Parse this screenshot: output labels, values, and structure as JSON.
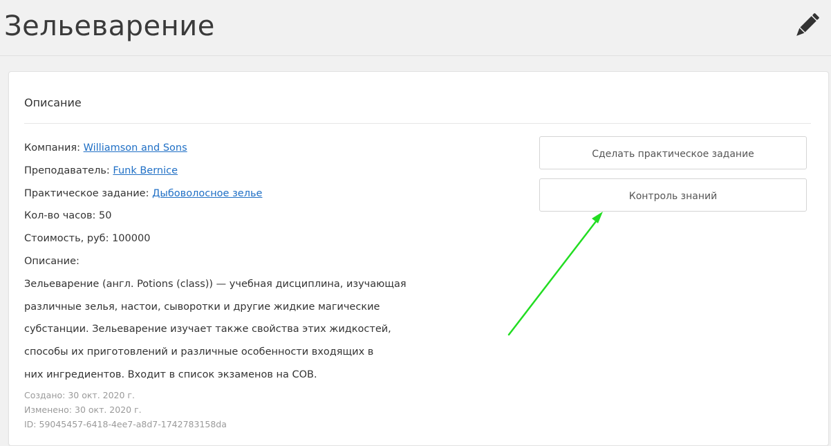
{
  "header": {
    "title": "Зельеварение",
    "edit_icon": "pencil-icon"
  },
  "card": {
    "section_title": "Описание",
    "company": {
      "label": "Компания: ",
      "value": "Williamson and Sons"
    },
    "teacher": {
      "label": "Преподаватель: ",
      "value": "Funk Bernice"
    },
    "practical_task": {
      "label": "Практическое задание: ",
      "value": "Дыбоволосное зелье"
    },
    "hours": "Кол-во часов: 50",
    "cost": "Стоимость, руб: 100000",
    "description_label": "Описание:",
    "description_lines": [
      "Зельеварение (англ. Potions (class)) — учебная дисциплина, изучающая",
      "различные зелья, настои, сыворотки и другие жидкие магические",
      "субстанции. Зельеварение изучает также свойства этих жидкостей,",
      "способы их приготовлений и различные особенности входящих в",
      "них ингредиентов. Входит в список экзаменов на СОВ."
    ],
    "created": "Создано: 30 окт. 2020 г.",
    "modified": "Изменено: 30 окт. 2020 г.",
    "id": "ID: 59045457-6418-4ee7-a8d7-1742783158da"
  },
  "actions": {
    "practical_button": "Сделать практическое задание",
    "knowledge_button": "Контроль знаний"
  },
  "annotation": {
    "arrow_color": "#22dd22"
  },
  "colors": {
    "link": "#1f6fc5",
    "background": "#f1f1f1",
    "meta_text": "#9a9a9a"
  }
}
